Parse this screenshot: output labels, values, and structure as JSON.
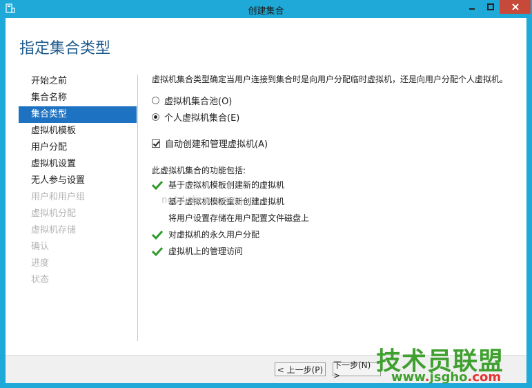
{
  "window": {
    "title": "创建集合",
    "app_icon": "server-manager-icon",
    "controls": [
      "minimize-icon",
      "maximize-icon",
      "close-icon"
    ],
    "colors": {
      "frame": "#1fa9d8",
      "close": "#c7493a",
      "heading": "#1e5a8c",
      "active_nav": "#1e72c2",
      "check": "#2e9a2e"
    }
  },
  "page": {
    "heading": "指定集合类型"
  },
  "nav": {
    "items": [
      {
        "label": "开始之前",
        "state": "normal"
      },
      {
        "label": "集合名称",
        "state": "normal"
      },
      {
        "label": "集合类型",
        "state": "active"
      },
      {
        "label": "虚拟机模板",
        "state": "normal"
      },
      {
        "label": "用户分配",
        "state": "normal"
      },
      {
        "label": "虚拟机设置",
        "state": "normal"
      },
      {
        "label": "无人参与设置",
        "state": "normal"
      },
      {
        "label": "用户和用户组",
        "state": "disabled"
      },
      {
        "label": "虚拟机分配",
        "state": "disabled"
      },
      {
        "label": "虚拟机存储",
        "state": "disabled"
      },
      {
        "label": "确认",
        "state": "disabled"
      },
      {
        "label": "进度",
        "state": "disabled"
      },
      {
        "label": "状态",
        "state": "disabled"
      }
    ]
  },
  "main": {
    "description": "虚拟机集合类型确定当用户连接到集合时是向用户分配临时虚拟机，还是向用户分配个人虚拟机。",
    "options": [
      {
        "label": "虚拟机集合池(O)",
        "checked": false
      },
      {
        "label": "个人虚拟机集合(E)",
        "checked": true
      }
    ],
    "auto_create": {
      "label": "自动创建和管理虚拟机(A)",
      "checked": true
    },
    "features_title": "此虚拟机集合的功能包括:",
    "features": [
      {
        "label": "基于虚拟机模板创建新的虚拟机",
        "supported": true
      },
      {
        "label": "基于虚拟机模板重新创建虚拟机",
        "supported": false
      },
      {
        "label": "将用户设置存储在用户配置文件磁盘上",
        "supported": false
      },
      {
        "label": "对虚拟机的永久用户分配",
        "supported": true
      },
      {
        "label": "虚拟机上的管理访问",
        "supported": true
      }
    ]
  },
  "watermark": {
    "text": "net/xiezuoyong"
  },
  "footer": {
    "prev_label": "< 上一步(P)",
    "next_label": "下一步(N) >"
  },
  "logo": {
    "main": "技术员联盟",
    "url_prefix": "www",
    "url_mid": "jsgho",
    "url_suffix": "com"
  }
}
